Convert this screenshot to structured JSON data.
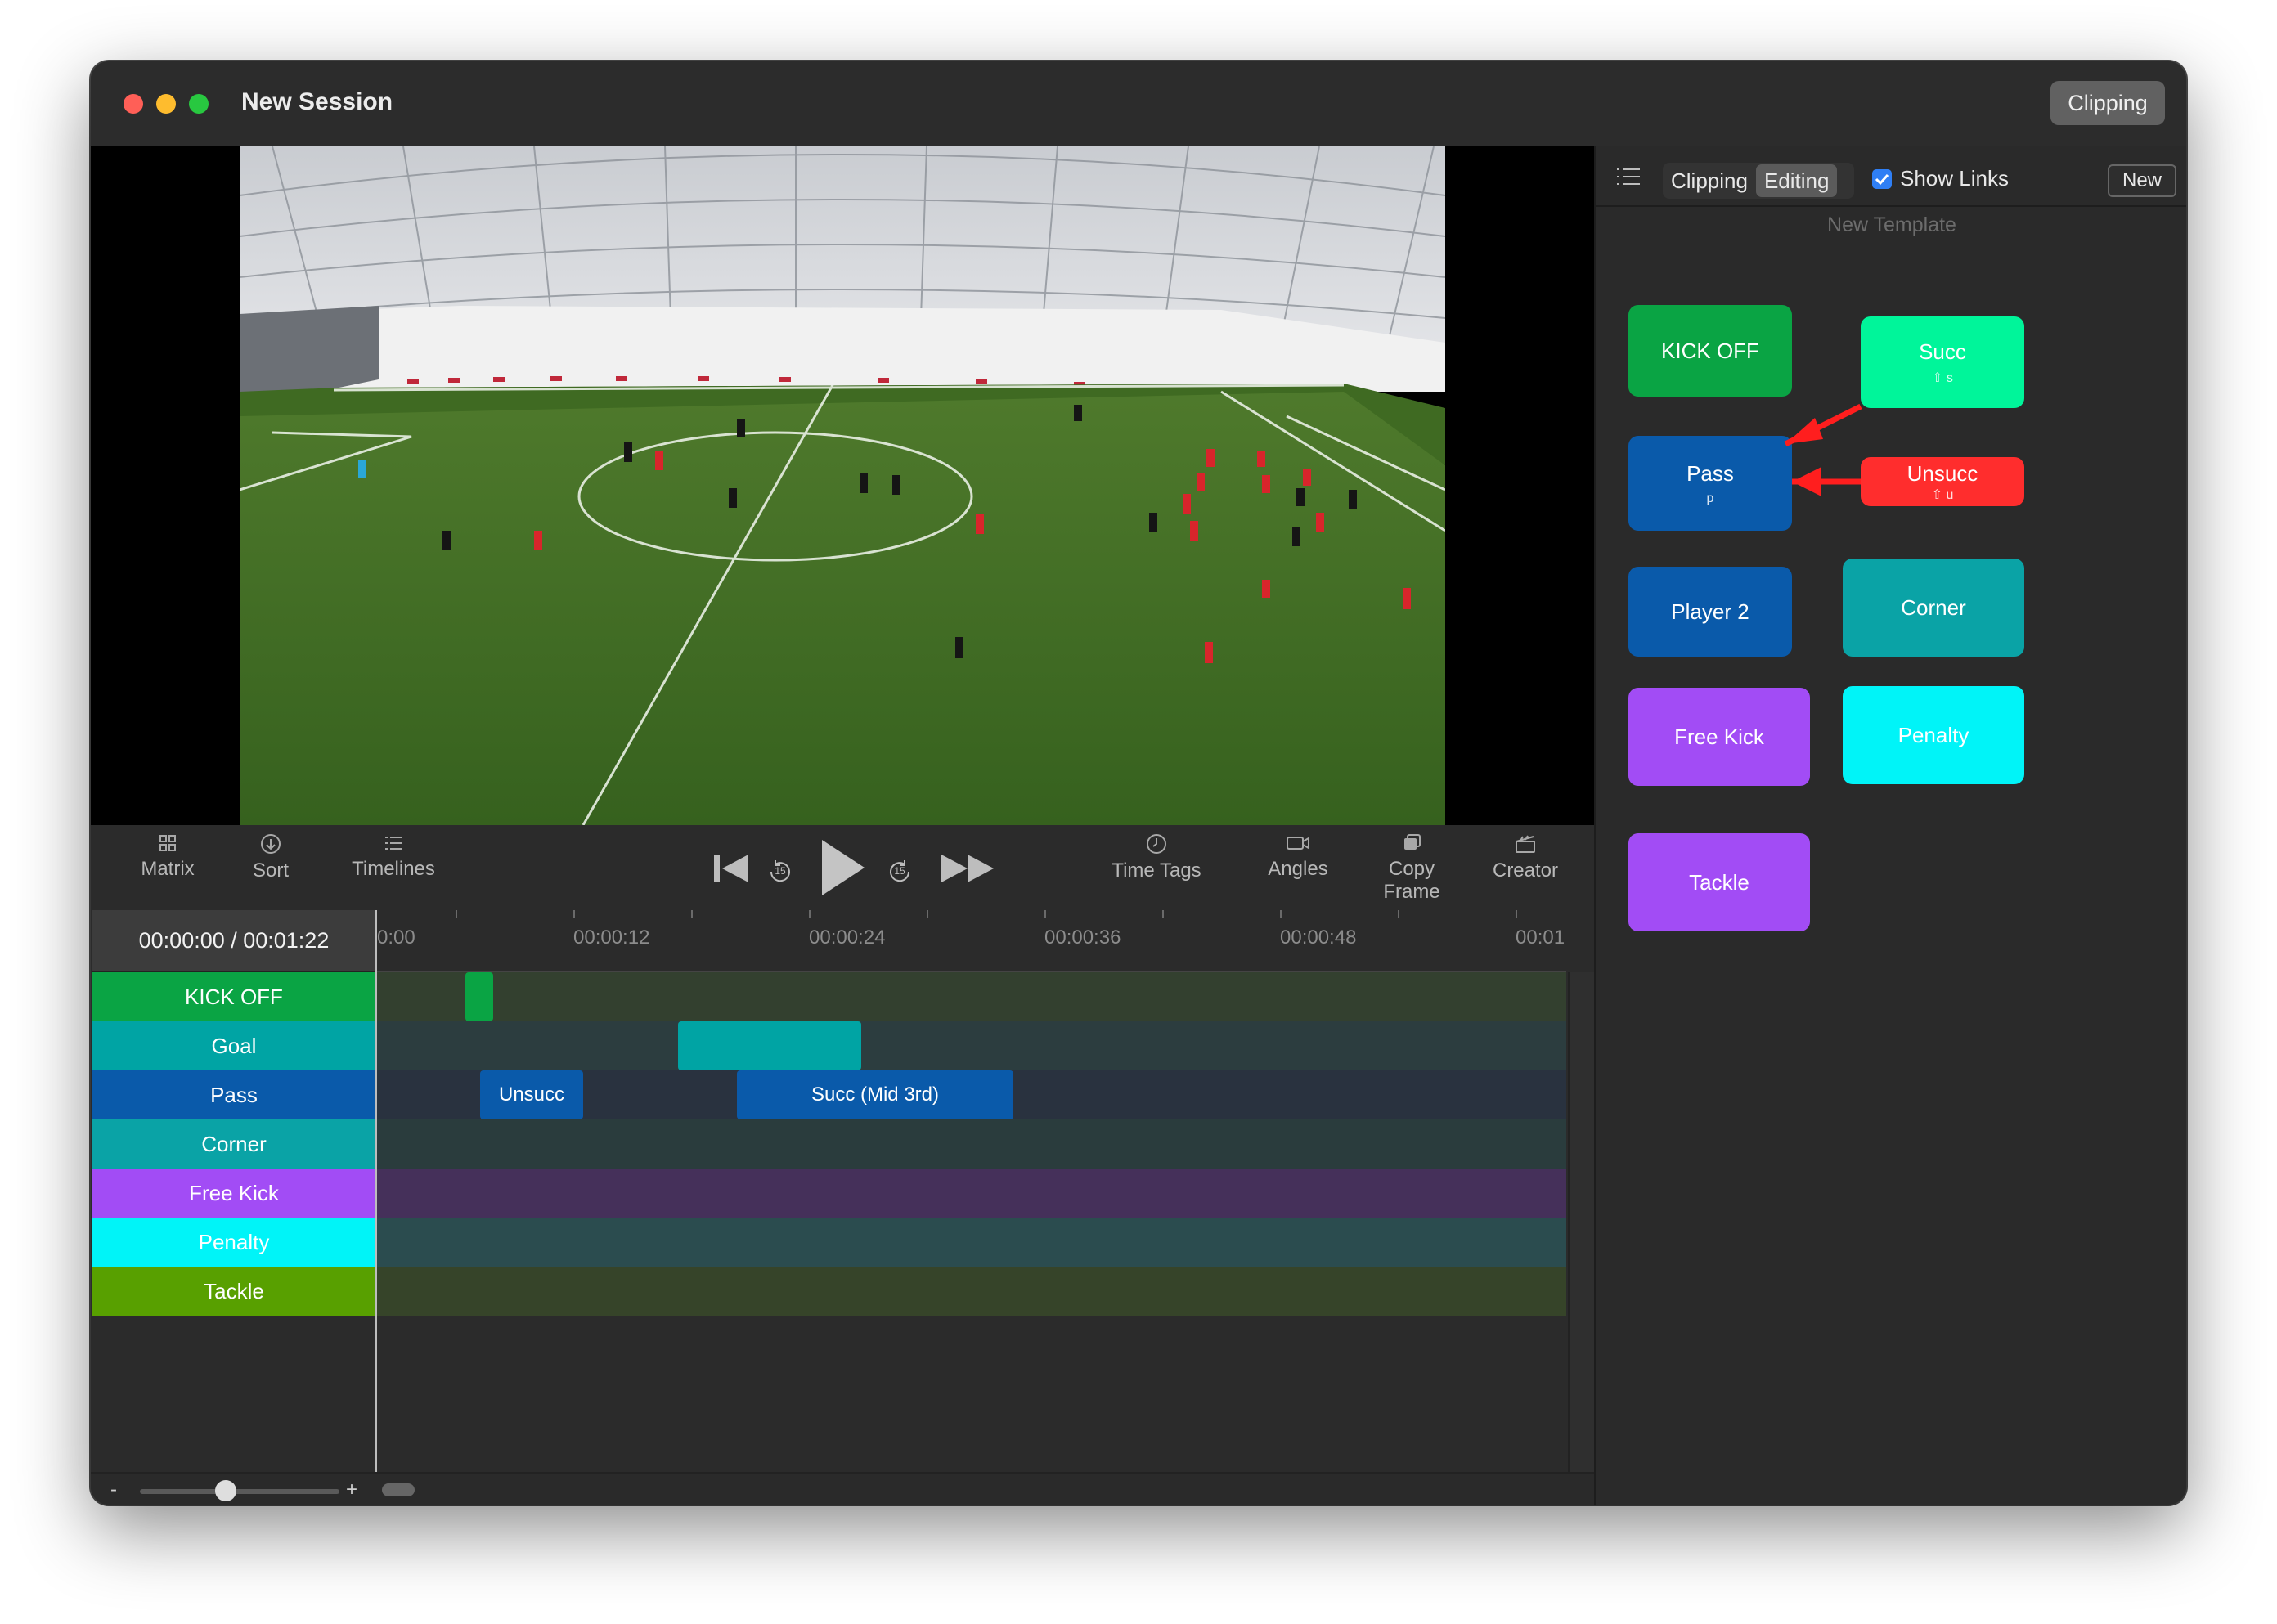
{
  "window": {
    "title": "New Session",
    "mode_button": "Clipping"
  },
  "toolbar": {
    "matrix": "Matrix",
    "sort": "Sort",
    "timelines": "Timelines",
    "time_tags": "Time Tags",
    "angles": "Angles",
    "copy_frame_line1": "Copy",
    "copy_frame_line2": "Frame",
    "creator": "Creator",
    "skip_back_seconds": "15",
    "skip_forward_seconds": "15"
  },
  "timeline": {
    "time_display": "00:00:00 / 00:01:22",
    "ticks": [
      "0:00",
      "00:00:12",
      "00:00:24",
      "00:00:36",
      "00:00:48",
      "00:01"
    ],
    "rows": [
      {
        "label": "KICK OFF",
        "color": "#0aa444",
        "track_color": "#33402f"
      },
      {
        "label": "Goal",
        "color": "#00a4a4",
        "track_color": "#2c3d3f"
      },
      {
        "label": "Pass",
        "color": "#0a5aaa",
        "track_color": "#29323f"
      },
      {
        "label": "Corner",
        "color": "#0aa3a6",
        "track_color": "#2a3c3d"
      },
      {
        "label": "Free Kick",
        "color": "#a24cf5",
        "track_color": "#45305a"
      },
      {
        "label": "Penalty",
        "color": "#00f4f8",
        "track_color": "#2b4c4f"
      },
      {
        "label": "Tackle",
        "color": "#58a000",
        "track_color": "#364429"
      }
    ],
    "clips": {
      "kickoff": "",
      "goal": "",
      "pass_unsucc": "Unsucc",
      "pass_succ": "Succ (Mid 3rd)"
    },
    "zoom_minus": "-",
    "zoom_plus": "+"
  },
  "panel": {
    "segment_clipping": "Clipping",
    "segment_editing": "Editing",
    "show_links_label": "Show Links",
    "show_links_checked": true,
    "new_button": "New",
    "template_name": "New Template",
    "buttons": {
      "kickoff": {
        "label": "KICK OFF",
        "color": "#0aa444"
      },
      "succ": {
        "label": "Succ",
        "hotkey": "⇧ s",
        "color": "#00f59a"
      },
      "pass": {
        "label": "Pass",
        "hotkey": "p",
        "color": "#0a5aaa"
      },
      "unsucc": {
        "label": "Unsucc",
        "hotkey": "⇧ u",
        "color": "#ff2d2d"
      },
      "player2": {
        "label": "Player 2",
        "color": "#0a5aaa"
      },
      "corner": {
        "label": "Corner",
        "color": "#0aa3a6"
      },
      "freekick": {
        "label": "Free Kick",
        "color": "#a24cf5"
      },
      "penalty": {
        "label": "Penalty",
        "color": "#00f4f8"
      },
      "tackle": {
        "label": "Tackle",
        "color": "#a24cf5"
      }
    }
  }
}
